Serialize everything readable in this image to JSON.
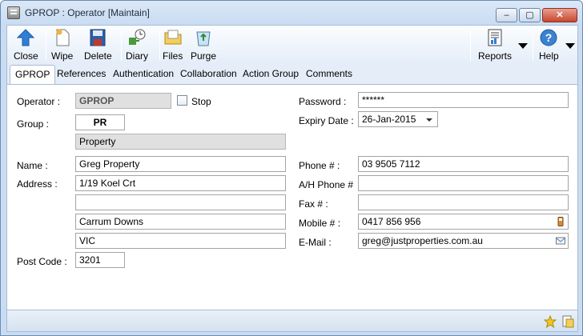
{
  "window": {
    "title": "GPROP : Operator [Maintain]"
  },
  "window_controls": {
    "minimize": "–",
    "maximize": "▢",
    "close": "✕"
  },
  "toolbar": {
    "close_label": "Close",
    "wipe_label": "Wipe",
    "delete_label": "Delete",
    "diary_label": "Diary",
    "files_label": "Files",
    "purge_label": "Purge",
    "reports_label": "Reports",
    "help_label": "Help"
  },
  "tabs": [
    "GPROP",
    "References",
    "Authentication",
    "Collaboration",
    "Action Group",
    "Comments"
  ],
  "form": {
    "operator": {
      "label": "Operator :",
      "value": "GPROP"
    },
    "stop": {
      "label": "Stop",
      "checked": false
    },
    "group": {
      "label": "Group :",
      "code": "PR",
      "description": "Property"
    },
    "name": {
      "label": "Name :",
      "value": "Greg Property"
    },
    "address": {
      "label": "Address :",
      "line1": "1/19 Koel Crt",
      "line2": "",
      "line3": "Carrum Downs",
      "line4": "VIC"
    },
    "postcode": {
      "label": "Post Code :",
      "value": "3201"
    },
    "password": {
      "label": "Password :",
      "value": "******"
    },
    "expiry": {
      "label": "Expiry Date :",
      "value": "26-Jan-2015"
    },
    "phone": {
      "label": "Phone # :",
      "value": "03 9505 7112"
    },
    "ah_phone": {
      "label": "A/H  Phone #",
      "value": ""
    },
    "fax": {
      "label": "Fax # :",
      "value": ""
    },
    "mobile": {
      "label": "Mobile # :",
      "value": "0417 856 956"
    },
    "email": {
      "label": "E-Mail :",
      "value": "greg@justproperties.com.au"
    }
  },
  "colors": {
    "accent": "#2f7ed8",
    "panel_border": "#a9bcd4",
    "readonly": "#e0e0e0"
  }
}
